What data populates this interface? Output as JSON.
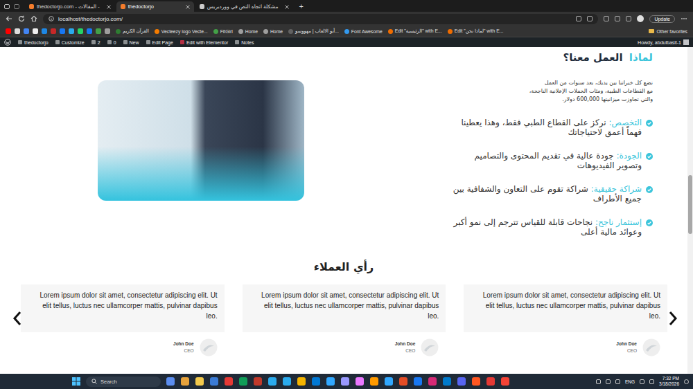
{
  "browser": {
    "tabs": [
      {
        "label": "thedoctorjo.com - المقالات -",
        "selected": false
      },
      {
        "label": "thedoctorjo",
        "selected": true
      },
      {
        "label": "مشكلة اتجاه النص في ووردبريس",
        "selected": false
      }
    ],
    "new_tab": "+",
    "address": "localhost/thedoctorjo.com/",
    "update_button": "Update",
    "bookmarks": [
      "القرآن الكريم",
      "Vecteezy logo Vecte...",
      "FitGirl",
      "Home",
      "Home",
      "أبو الالعاب | مهووسو...",
      "Font Awesome",
      "Edit \"الرئيسية\" with E...",
      "Edit \"لماذا نحن\" with E..."
    ],
    "other_favorites": "Other favorites"
  },
  "admin_bar": {
    "items": [
      "thedoctorjo",
      "Customize",
      "2",
      "0",
      "New",
      "Edit Page",
      "Edit with Elementor",
      "Notes"
    ],
    "howdy": "Howdy, abdulbasit-1"
  },
  "why_us": {
    "heading_highlight": "لماذا",
    "heading_rest": "العمل معنا؟",
    "intro": [
      "نضع كل خبراتنا بين يديك، بعد سنوات من العمل",
      "مع القطاعات الطبية، ومئات الحملات الإعلانية الناجحة،",
      "والتي تجاوزت ميزانيتها 600,000 دولار."
    ],
    "features": [
      {
        "label": "التخصص:",
        "text": "نركز على القطاع الطبي فقط، وهذا يعطينا فهماً أعمق لاحتياجاتك"
      },
      {
        "label": "الجودة:",
        "text": "جودة عالية في تقديم المحتوى والتصاميم وتصوير الفيديوهات"
      },
      {
        "label": "شراكة حقيقية:",
        "text": "شراكة تقوم على التعاون والشفافية بين جميع الأطراف"
      },
      {
        "label": "إستثمار ناجح:",
        "text": "نجاحات قابلة للقياس تترجم إلى نمو أكبر وعوائد مالية أعلى"
      }
    ]
  },
  "testimonials": {
    "heading": "رأي العملاء",
    "items": [
      {
        "quote": "Lorem ipsum dolor sit amet, consectetur adipiscing elit. Ut elit tellus, luctus nec ullamcorper mattis, pulvinar dapibus leo.",
        "name": "John Doe",
        "role": "CEO"
      },
      {
        "quote": "Lorem ipsum dolor sit amet, consectetur adipiscing elit. Ut elit tellus, luctus nec ullamcorper mattis, pulvinar dapibus leo.",
        "name": "John Doe",
        "role": "CEO"
      },
      {
        "quote": "Lorem ipsum dolor sit amet, consectetur adipiscing elit. Ut elit tellus, luctus nec ullamcorper mattis, pulvinar dapibus leo.",
        "name": "John Doe",
        "role": "CEO"
      }
    ]
  },
  "taskbar": {
    "search": "Search",
    "language": "ENG",
    "time": "7:32 PM",
    "date": "3/18/2026"
  }
}
